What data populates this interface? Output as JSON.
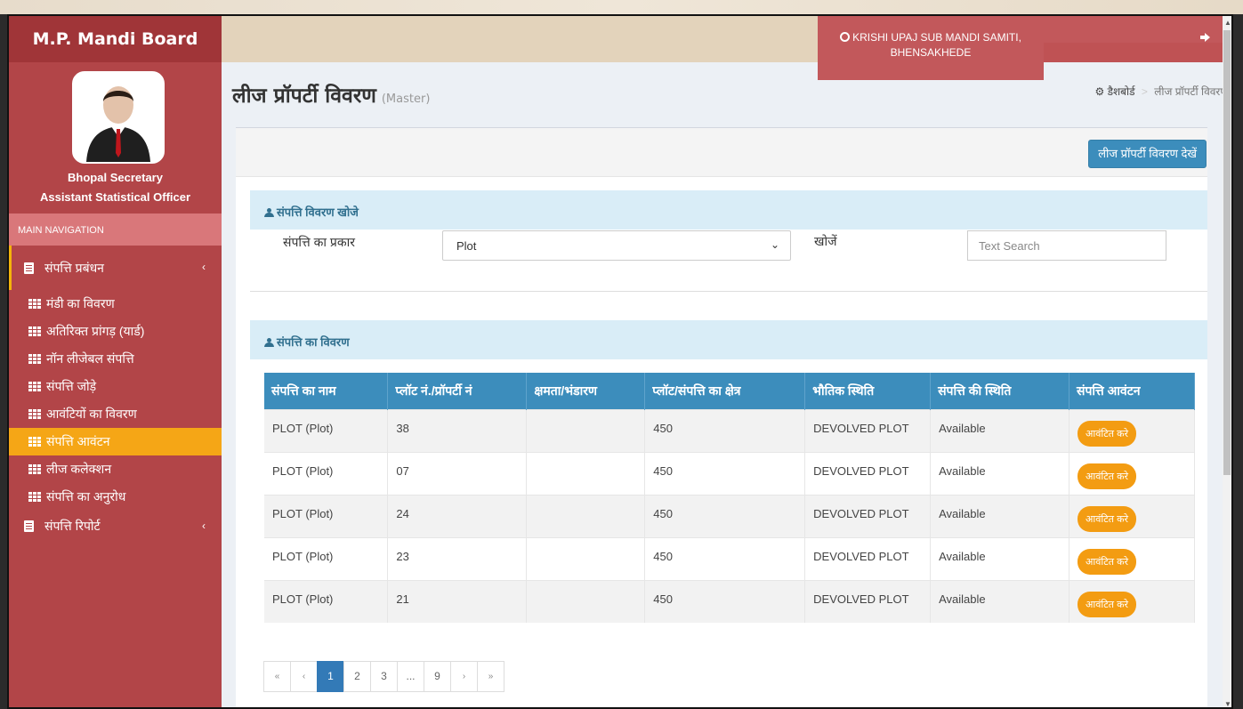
{
  "app": {
    "logo": "M.P. Mandi Board"
  },
  "user": {
    "line1": "Bhopal Secretary",
    "line2": "Assistant Statistical Officer"
  },
  "header": {
    "samiti_line1": "KRISHI UPAJ SUB MANDI SAMITI,",
    "samiti_line2": "BHENSAKHEDE",
    "signout_icon": "sign-out-icon"
  },
  "nav": {
    "header": "MAIN NAVIGATION",
    "group1": "संपत्ति प्रबंधन",
    "items": [
      "मंडी का विवरण",
      "अतिरिक्त प्रांगड़ (यार्ड)",
      "नॉन लीजेबल संपत्ति",
      "संपत्ति जोड़े",
      "आवंटियों का विवरण",
      "संपत्ति आवंटन",
      "लीज कलेक्शन",
      "संपत्ति का अनुरोध"
    ],
    "active_index": 5,
    "group2": "संपत्ति रिपोर्ट"
  },
  "page": {
    "title": "लीज प्रॉपर्टी विवरण",
    "subtitle": "(Master)",
    "breadcrumb_home": "डैशबोर्ड",
    "breadcrumb_current": "लीज प्रॉपर्टी विवरण",
    "view_button": "लीज प्रॉपर्टी विवरण देखें"
  },
  "search": {
    "section_title": "संपत्ति विवरण खोजे",
    "type_label": "संपत्ति का प्रकार",
    "type_value": "Plot",
    "search_label": "खोजें",
    "search_placeholder": "Text Search"
  },
  "details": {
    "section_title": "संपत्ति का विवरण",
    "columns": [
      "संपत्ति का नाम",
      "प्लॉट नं./प्रॉपर्टी नं",
      "क्षमता/भंडारण",
      "प्लॉट/संपत्ति का क्षेत्र",
      "भौतिक स्थिति",
      "संपत्ति की स्थिति",
      "संपत्ति आवंटन"
    ],
    "rows": [
      {
        "name": "PLOT (Plot)",
        "number": "38",
        "capacity": "",
        "area": "450",
        "physical": "DEVOLVED PLOT",
        "status": "Available",
        "action": "आवंटित करे"
      },
      {
        "name": "PLOT (Plot)",
        "number": "07",
        "capacity": "",
        "area": "450",
        "physical": "DEVOLVED PLOT",
        "status": "Available",
        "action": "आवंटित करे"
      },
      {
        "name": "PLOT (Plot)",
        "number": "24",
        "capacity": "",
        "area": "450",
        "physical": "DEVOLVED PLOT",
        "status": "Available",
        "action": "आवंटित करे"
      },
      {
        "name": "PLOT (Plot)",
        "number": "23",
        "capacity": "",
        "area": "450",
        "physical": "DEVOLVED PLOT",
        "status": "Available",
        "action": "आवंटित करे"
      },
      {
        "name": "PLOT (Plot)",
        "number": "21",
        "capacity": "",
        "area": "450",
        "physical": "DEVOLVED PLOT",
        "status": "Available",
        "action": "आवंटित करे"
      }
    ]
  },
  "pagination": {
    "first": "«",
    "prev": "‹",
    "pages": [
      "1",
      "2",
      "3",
      "...",
      "9"
    ],
    "active": "1",
    "next": "›",
    "last": "»"
  },
  "colors": {
    "sidebar": "#b24548",
    "active_item": "#f5a616",
    "table_header": "#3c8dbc",
    "available": "#28a745"
  }
}
